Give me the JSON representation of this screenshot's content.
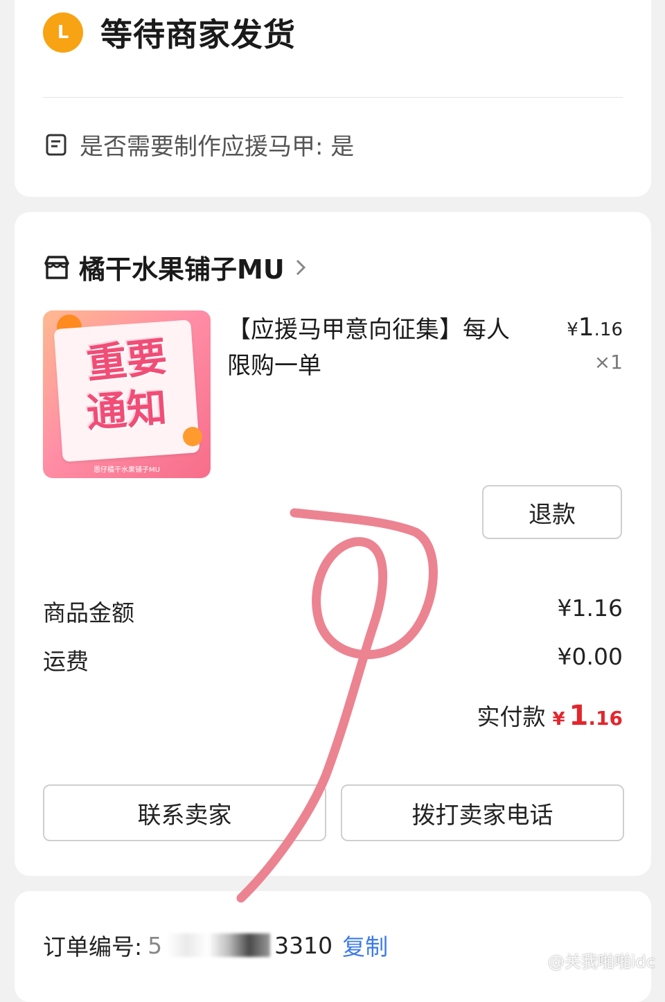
{
  "status": {
    "badge": "L",
    "title": "等待商家发货",
    "note": "是否需要制作应援马甲: 是"
  },
  "shop": {
    "name": "橘干水果铺子MU"
  },
  "product": {
    "title": "【应援马甲意向征集】每人限购一单",
    "price_symbol": "¥",
    "price_int": "1",
    "price_dec": ".16",
    "quantity": "×1",
    "thumb_line1": "重要",
    "thumb_line2": "通知",
    "thumb_footer": "恩仔橘干水果铺子MU"
  },
  "actions": {
    "refund": "退款",
    "contact_seller": "联系卖家",
    "call_seller": "拨打卖家电话"
  },
  "summary": {
    "goods_label": "商品金额",
    "goods_value": "¥1.16",
    "shipping_label": "运费",
    "shipping_value": "¥0.00",
    "total_label": "实付款",
    "total_symbol": "¥",
    "total_int": "1",
    "total_dec": ".16"
  },
  "order": {
    "number_label": "订单编号:",
    "number_prefix": "5",
    "number_suffix": "3310",
    "copy": "复制"
  },
  "watermark": "@关我啪啪idc",
  "colors": {
    "status_badge": "#f7a313",
    "price_red": "#e3262e",
    "link_blue": "#3d7be6",
    "scribble": "#ec8391"
  }
}
